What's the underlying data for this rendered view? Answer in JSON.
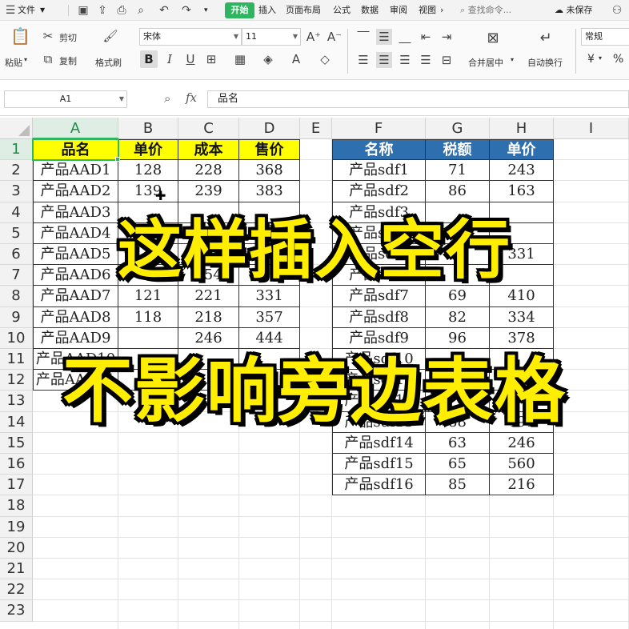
{
  "menubar": {
    "file_menu": "文件",
    "tabs": [
      "开始",
      "插入",
      "页面布局",
      "公式",
      "数据",
      "审阅",
      "视图"
    ],
    "search": "查找命令...",
    "save_status": "未保存"
  },
  "ribbon": {
    "paste": "粘贴",
    "cut": "剪切",
    "copy": "复制",
    "format_painter": "格式刷",
    "font_name": "宋体",
    "font_size": "11",
    "bold": "B",
    "italic": "I",
    "underline": "U",
    "merge_center": "合并居中",
    "wrap_text": "自动换行",
    "number_format": "常规",
    "currency_symbol": "¥",
    "percent_symbol": "%"
  },
  "formula_bar": {
    "name_box": "A1",
    "fx": "fx",
    "content": "品名"
  },
  "columns": [
    "A",
    "B",
    "C",
    "D",
    "E",
    "F",
    "G",
    "H",
    "I"
  ],
  "rows": [
    "1",
    "2",
    "3",
    "4",
    "5",
    "6",
    "7",
    "8",
    "9",
    "10",
    "11",
    "12",
    "13",
    "14",
    "15",
    "16",
    "17",
    "18",
    "19",
    "20",
    "21",
    "22",
    "23"
  ],
  "left_table": {
    "headers": [
      "品名",
      "单价",
      "成本",
      "售价"
    ],
    "rows": [
      [
        "产品AAD1",
        "128",
        "228",
        "368"
      ],
      [
        "产品AAD2",
        "139",
        "239",
        "383"
      ],
      [
        "产品AAD3",
        "",
        "",
        ""
      ],
      [
        "产品AAD4",
        "15",
        "",
        ""
      ],
      [
        "产品AAD5",
        "",
        "",
        ""
      ],
      [
        "产品AAD6",
        "15",
        "254",
        "38"
      ],
      [
        "产品AAD7",
        "121",
        "221",
        "331"
      ],
      [
        "产品AAD8",
        "118",
        "218",
        "357"
      ],
      [
        "产品AAD9",
        "",
        "246",
        "444"
      ],
      [
        "产品AAD10",
        "",
        "",
        ""
      ],
      [
        "产品AAD11",
        "",
        "",
        ""
      ]
    ]
  },
  "right_table": {
    "headers": [
      "名称",
      "税额",
      "单价"
    ],
    "rows": [
      [
        "产品sdf1",
        "71",
        "243"
      ],
      [
        "产品sdf2",
        "86",
        "163"
      ],
      [
        "产品sdf3",
        "",
        ""
      ],
      [
        "产品sdf4",
        "",
        ""
      ],
      [
        "产品sdf5",
        "55",
        "331"
      ],
      [
        "产品sdf6",
        "",
        ""
      ],
      [
        "产品sdf7",
        "69",
        "410"
      ],
      [
        "产品sdf8",
        "82",
        "334"
      ],
      [
        "产品sdf9",
        "96",
        "378"
      ],
      [
        "产品sdf10",
        "",
        ""
      ],
      [
        "产品sdf11",
        "",
        ""
      ],
      [
        "产品sdf12",
        "",
        ""
      ],
      [
        "产品sdf13",
        "88",
        "491"
      ],
      [
        "产品sdf14",
        "63",
        "246"
      ],
      [
        "产品sdf15",
        "65",
        "560"
      ],
      [
        "产品sdf16",
        "85",
        "216"
      ]
    ]
  },
  "overlay": {
    "line1": "这样插入空行",
    "line2": "不影响旁边表格"
  },
  "colors": {
    "accent": "#2fb560",
    "left_header_bg": "#ffff00",
    "right_header_bg": "#2e6fb0",
    "caption_text": "#ffee00"
  }
}
